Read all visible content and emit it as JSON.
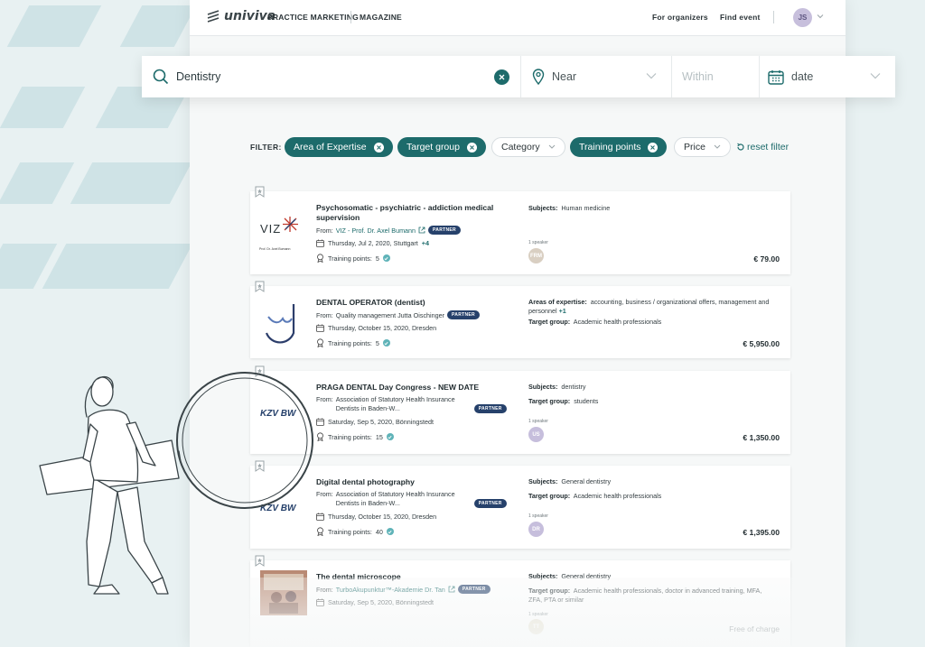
{
  "nav": {
    "brand": "univiva",
    "links": [
      "PRACTICE MARKETING",
      "MAGAZINE"
    ],
    "right_links": [
      "For organizers",
      "Find event"
    ],
    "user_initials": "JS"
  },
  "search": {
    "query": "Dentistry",
    "near_placeholder": "Near",
    "within_placeholder": "Within",
    "date_placeholder": "date"
  },
  "filter": {
    "label": "FILTER:",
    "chips": [
      {
        "label": "Area of Expertise",
        "active": true
      },
      {
        "label": "Target group",
        "active": true
      },
      {
        "label": "Category",
        "active": false
      },
      {
        "label": "Training points",
        "active": true
      },
      {
        "label": "Price",
        "active": false
      }
    ],
    "reset_label": "reset filter"
  },
  "events": [
    {
      "title": "Psychosomatic - psychiatric - addiction medical supervision",
      "from_label": "From:",
      "organizer": "VIZ - Prof. Dr. Axel Bumann",
      "partner": "PARTNER",
      "date": "Thursday, Jul 2, 2020, Stuttgart",
      "more": "+4",
      "points_label": "Training points:",
      "points": "5",
      "meta": [
        {
          "k": "Subjects:",
          "v": "Human medicine"
        }
      ],
      "speaker_label": "1 speaker",
      "speaker": "FRM",
      "price": "€ 79.00",
      "logo_text": "VIZ",
      "logo_caption": "Prof. Dr. Axel Bumann"
    },
    {
      "title": "DENTAL OPERATOR (dentist)",
      "from_label": "From:",
      "organizer": "Quality management Jutta Oischinger",
      "partner": "PARTNER",
      "date": "Thursday, October 15, 2020, Dresden",
      "points_label": "Training points:",
      "points": "5",
      "meta": [
        {
          "k": "Areas of expertise:",
          "v": "accounting, business / organizational offers, management and personnel",
          "more": "+1"
        },
        {
          "k": "Target group:",
          "v": "Academic health professionals"
        }
      ],
      "price": "€ 5,950.00"
    },
    {
      "title": "PRAGA DENTAL Day Congress - NEW DATE",
      "from_label": "From:",
      "organizer": "Association of Statutory Health Insurance Dentists in Baden-W...",
      "partner": "PARTNER",
      "date": "Saturday, Sep 5, 2020, Bönningstedt",
      "points_label": "Training points:",
      "points": "15",
      "meta": [
        {
          "k": "Subjects:",
          "v": "dentistry"
        },
        {
          "k": "Target group:",
          "v": "students"
        }
      ],
      "speaker_label": "1 speaker",
      "speaker": "US",
      "price": "€ 1,350.00",
      "logo_text": "KZV BW"
    },
    {
      "title": "Digital dental photography",
      "from_label": "From:",
      "organizer": "Association of Statutory Health Insurance Dentists in Baden-W...",
      "partner": "PARTNER",
      "date": "Thursday, October 15, 2020, Dresden",
      "points_label": "Training points:",
      "points": "40",
      "meta": [
        {
          "k": "Subjects:",
          "v": "General dentistry"
        },
        {
          "k": "Target group:",
          "v": "Academic health professionals"
        }
      ],
      "speaker_label": "1 speaker",
      "speaker": "DR",
      "price": "€ 1,395.00",
      "logo_text": "KZV BW"
    },
    {
      "title": "The dental microscope",
      "from_label": "From:",
      "organizer": "TurboAkupunktur™-Akademie Dr. Tan",
      "partner": "PARTNER",
      "date": "Saturday, Sep 5, 2020, Bönningstedt",
      "meta": [
        {
          "k": "Subjects:",
          "v": "General dentistry"
        },
        {
          "k": "Target group:",
          "v": "Academic health professionals, doctor in advanced training, MFA, ZFA, PTA or similar"
        }
      ],
      "speaker_label": "1 speaker",
      "speaker": "TT",
      "price": "Free of charge"
    }
  ],
  "colors": {
    "accent": "#1d6b6b",
    "partner": "#26416b",
    "avatar": "#c6bedc",
    "check": "#5fb3b8"
  }
}
